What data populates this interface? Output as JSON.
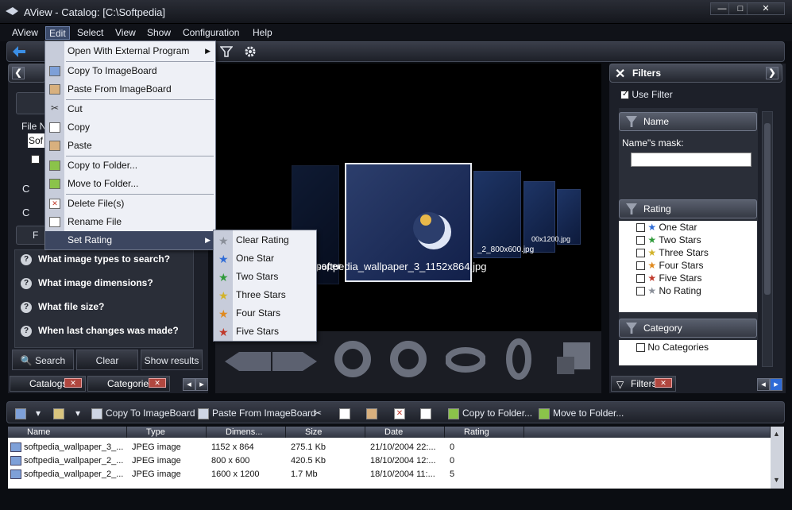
{
  "window": {
    "title": "AView - Catalog: [C:\\Softpedia]",
    "min_label": "—",
    "max_label": "□",
    "close_label": "✕"
  },
  "menubar": {
    "items": [
      "AView",
      "Edit",
      "Select",
      "View",
      "Show",
      "Configuration",
      "Help"
    ],
    "active": "Edit"
  },
  "left_panel": {
    "field_label": "File Na",
    "field_value": "Sof",
    "questions": [
      "What image types to search?",
      "What image dimensions?",
      "What file size?",
      "When last changes was made?"
    ],
    "buttons": {
      "search": "Search",
      "clear": "Clear",
      "show_results": "Show results"
    },
    "tabs": [
      "Catalogs",
      "Categories"
    ],
    "side_letters": [
      "C",
      "C",
      "F"
    ]
  },
  "edit_menu": {
    "items": [
      {
        "label": "Open With External Program",
        "submenu": true
      },
      {
        "label": "Copy To ImageBoard"
      },
      {
        "label": "Paste From ImageBoard"
      },
      {
        "label": "Cut"
      },
      {
        "label": "Copy"
      },
      {
        "label": "Paste"
      },
      {
        "label": "Copy to Folder..."
      },
      {
        "label": "Move to Folder..."
      },
      {
        "label": "Delete File(s)"
      },
      {
        "label": "Rename File"
      },
      {
        "label": "Set Rating",
        "submenu": true
      }
    ]
  },
  "rating_submenu": {
    "items": [
      "Clear Rating",
      "One Star",
      "Two Stars",
      "Three Stars",
      "Four Stars",
      "Five Stars"
    ]
  },
  "viewer": {
    "caption": "softpedia_wallpaper_3_1152x864.jpg",
    "side_captions": [
      "_2_800x600.jpg",
      "00x1200.jpg",
      "paper"
    ]
  },
  "filters": {
    "title": "Filters",
    "use_filter": "Use Filter",
    "name_section": "Name",
    "name_mask_label": "Name\"s mask:",
    "name_mask_value": "",
    "rating_section": "Rating",
    "ratings": [
      "One Star",
      "Two Stars",
      "Three Stars",
      "Four Stars",
      "Five Stars",
      "No Rating"
    ],
    "category_section": "Category",
    "categories": [
      "No Categories"
    ],
    "tab": "Filters"
  },
  "bottom_toolbar": {
    "copy_to_imageboard": "Copy To ImageBoard",
    "paste_from_imageboard": "Paste From ImageBoard",
    "copy_to_folder": "Copy to Folder...",
    "move_to_folder": "Move to Folder..."
  },
  "file_table": {
    "columns": [
      "Name",
      "Type",
      "Dimens...",
      "Size",
      "Date",
      "Rating"
    ],
    "rows": [
      {
        "name": "softpedia_wallpaper_3_...",
        "type": "JPEG image",
        "dims": "1152 x 864",
        "size": "275.1 Kb",
        "date": "21/10/2004 22:...",
        "rating": "0"
      },
      {
        "name": "softpedia_wallpaper_2_...",
        "type": "JPEG image",
        "dims": "800 x 600",
        "size": "420.5 Kb",
        "date": "18/10/2004 12:...",
        "rating": "0"
      },
      {
        "name": "softpedia_wallpaper_2_...",
        "type": "JPEG image",
        "dims": "1600 x 1200",
        "size": "1.7 Mb",
        "date": "18/10/2004 11:...",
        "rating": "5"
      }
    ]
  },
  "colors": {
    "one": "#2f6bd6",
    "two": "#2f9a3a",
    "three": "#d2b32a",
    "four": "#e08a1e",
    "five": "#c0392b",
    "none": "#8a8f99"
  }
}
